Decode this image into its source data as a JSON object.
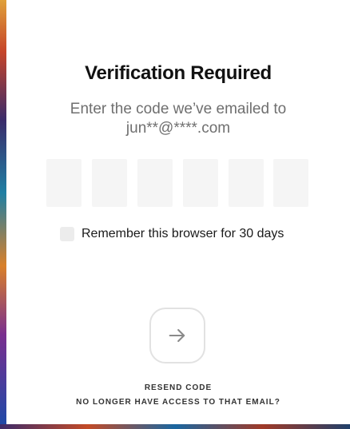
{
  "dialog": {
    "title": "Verification Required",
    "subtitle_line1": "Enter the code we’ve emailed to",
    "subtitle_line2": "jun**@****.com"
  },
  "code": {
    "digits": [
      "",
      "",
      "",
      "",
      "",
      ""
    ]
  },
  "remember": {
    "label": "Remember this browser for 30 days",
    "checked": false
  },
  "next_button": {
    "icon": "arrow-right-icon"
  },
  "links": {
    "resend": "RESEND CODE",
    "no_access": "NO LONGER HAVE ACCESS TO THAT EMAIL?"
  },
  "colors": {
    "card_background": "#ffffff",
    "code_box_background": "#f5f5f5",
    "subtitle_text": "#6f6f6f",
    "button_border": "#e2e2e2"
  }
}
